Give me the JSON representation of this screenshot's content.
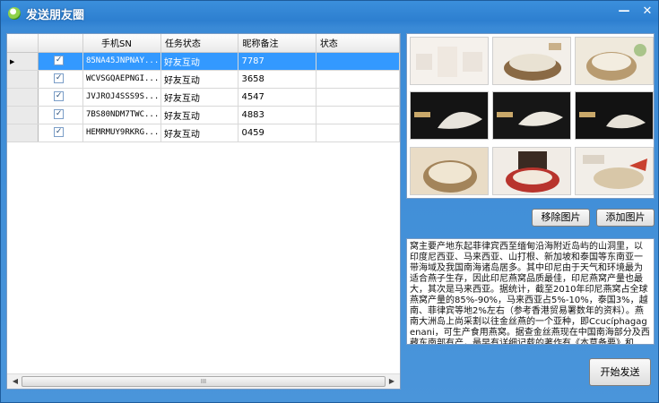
{
  "window": {
    "title": "发送朋友圈",
    "minimize": "—",
    "close": "✕"
  },
  "grid": {
    "columns": [
      "手机SN",
      "任务状态",
      "昵称备注",
      "状态"
    ],
    "rows": [
      {
        "checked": true,
        "sn": "85NA45JNPNAY...",
        "task_status": "好友互动",
        "nickname": "7787",
        "status": ""
      },
      {
        "checked": true,
        "sn": "WCVSGQAEPNGI...",
        "task_status": "好友互动",
        "nickname": "3658",
        "status": ""
      },
      {
        "checked": true,
        "sn": "JVJROJ4SSS9S...",
        "task_status": "好友互动",
        "nickname": "4547",
        "status": ""
      },
      {
        "checked": true,
        "sn": "7BS80NDM7TWC...",
        "task_status": "好友互动",
        "nickname": "4883",
        "status": ""
      },
      {
        "checked": true,
        "sn": "HEMRMUY9RKRG...",
        "task_status": "好友互动",
        "nickname": "0459",
        "status": ""
      }
    ],
    "selected_row_marker": "▶",
    "scroll_left": "◀",
    "scroll_right": "▶",
    "scroll_grip": "III"
  },
  "images": {
    "count": 9,
    "brand_label": "小燕子"
  },
  "buttons": {
    "remove_images": "移除图片",
    "add_images": "添加图片",
    "start_send": "开始发送"
  },
  "post_text": "窝主要产地东起菲律宾西至缅甸沿海附近岛屿的山洞里，以印度尼西亚、马来西亚、山打根、新加坡和泰国等东南亚一带海域及我国南海诸岛居多。其中印尼由于天气和环境最为适合燕子生存，因此印尼燕窝品质最佳，印尼燕窝产量也最大，其次是马来西亚。据统计，截至2010年印尼燕窝占全球燕窝产量的85%-90%，马来西亚占5%-10%，泰国3%，越南、菲律宾等地2%左右（参考香港贸易署数年的资料）。燕南大洲岛上尚采割以往金丝燕的一个亚种，即Ccucíphagagenani，可生产食用燕窝。据查金丝燕现在中国南海部分及西藏东南部有产，最早有详细记载的著作有《本草备要》和《本经"
}
